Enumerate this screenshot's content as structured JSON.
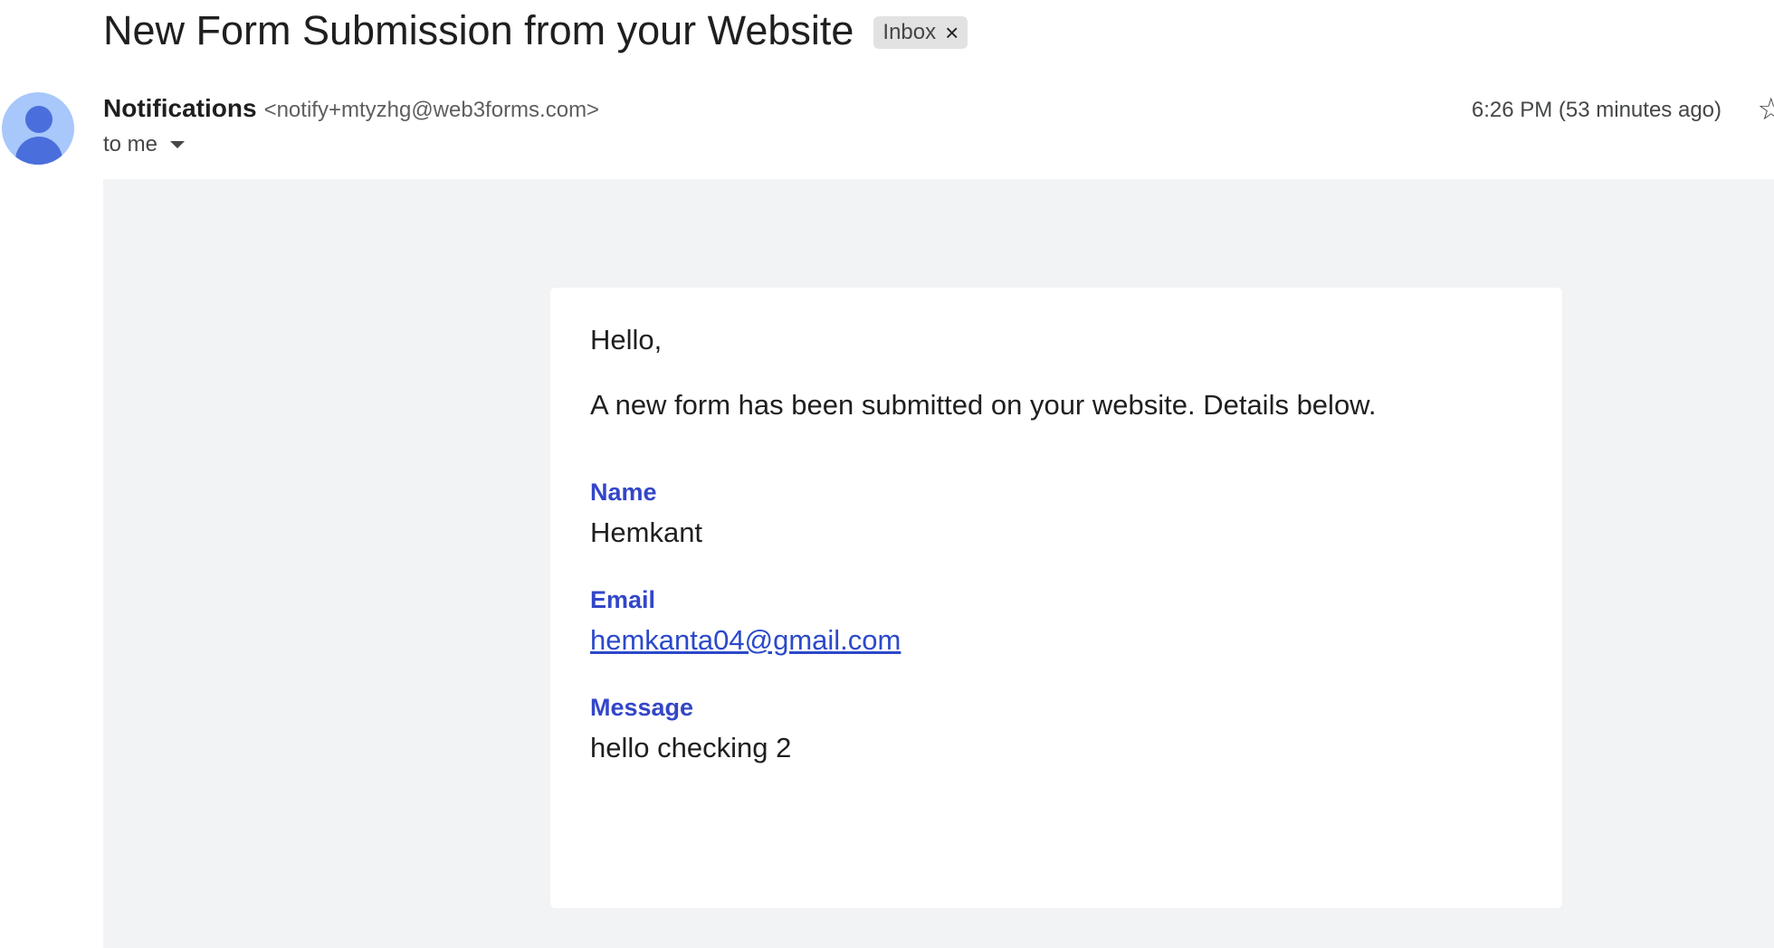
{
  "email": {
    "subject": "New Form Submission from your Website",
    "label_chip": {
      "text": "Inbox",
      "close": "×"
    },
    "sender": {
      "name": "Notifications",
      "address": "<notify+mtyzhg@web3forms.com>"
    },
    "recipient_text": "to me",
    "timestamp": "6:26 PM (53 minutes ago)",
    "star": "☆",
    "body": {
      "greeting": "Hello,",
      "intro": "A new form has been submitted on your website. Details below.",
      "fields": [
        {
          "label": "Name",
          "value": "Hemkant"
        },
        {
          "label": "Email",
          "value": "hemkanta04@gmail.com"
        },
        {
          "label": "Message",
          "value": "hello checking 2"
        }
      ]
    }
  },
  "colors": {
    "label_blue": "#3346c8",
    "link_blue": "#2b49c9",
    "body_background": "#f2f3f5",
    "avatar_light": "#a8c7fa",
    "avatar_dark": "#4a6fdc"
  }
}
